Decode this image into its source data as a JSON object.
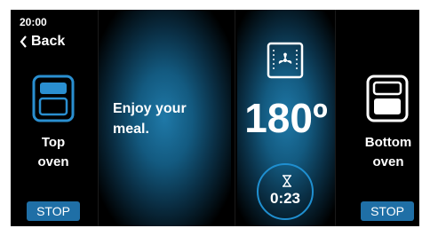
{
  "status": {
    "time": "20:00"
  },
  "nav": {
    "back_label": "Back"
  },
  "top_oven": {
    "label_line1": "Top",
    "label_line2": "oven",
    "stop_label": "STOP"
  },
  "bottom_oven": {
    "label_line1": "Bottom",
    "label_line2": "oven",
    "stop_label": "STOP"
  },
  "message": {
    "line1": "Enjoy your",
    "line2": "meal."
  },
  "cooking": {
    "temperature": "180º",
    "timer": "0:23",
    "mode_icon": "fan-icon"
  },
  "colors": {
    "accent": "#1f6fa6",
    "glow": "#1f79a8",
    "timer_ring": "#1f8fd0"
  }
}
